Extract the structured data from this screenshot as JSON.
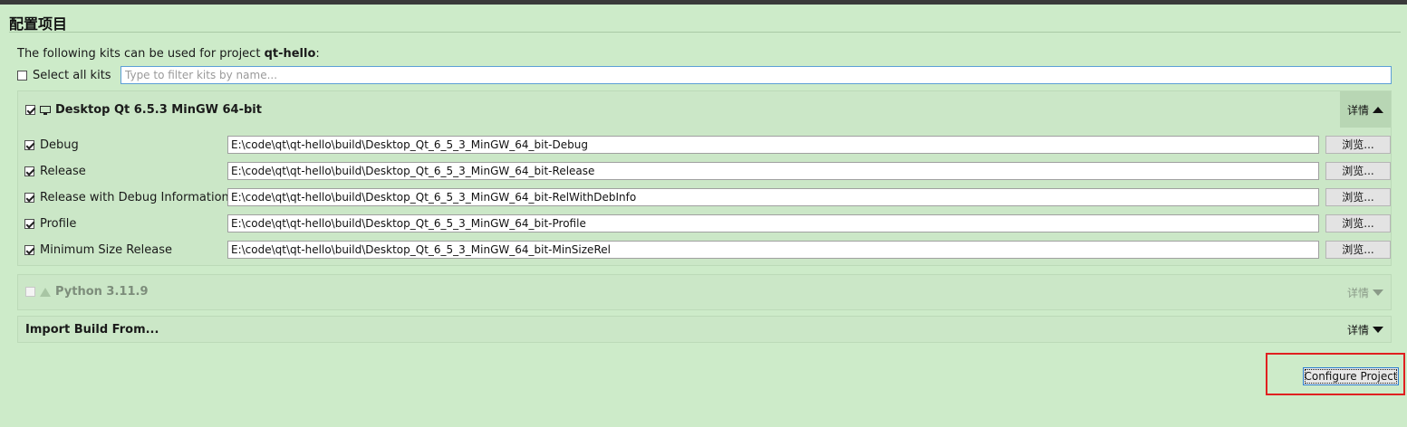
{
  "header": {
    "title": "配置项目"
  },
  "intro": {
    "prefix": "The following kits can be used for project ",
    "project": "qt-hello",
    "suffix": ":"
  },
  "select_all": {
    "label": "Select all kits",
    "checked": false
  },
  "filter": {
    "placeholder": "Type to filter kits by name...",
    "value": ""
  },
  "kits": [
    {
      "name": "Desktop Qt 6.5.3 MinGW 64-bit",
      "checked": true,
      "icon": "monitor-icon",
      "details_label": "详情",
      "expanded": true,
      "builds": [
        {
          "label": "Debug",
          "checked": true,
          "path": "E:\\code\\qt\\qt-hello\\build\\Desktop_Qt_6_5_3_MinGW_64_bit-Debug",
          "browse": "浏览..."
        },
        {
          "label": "Release",
          "checked": true,
          "path": "E:\\code\\qt\\qt-hello\\build\\Desktop_Qt_6_5_3_MinGW_64_bit-Release",
          "browse": "浏览..."
        },
        {
          "label": "Release with Debug Information",
          "checked": true,
          "path": "E:\\code\\qt\\qt-hello\\build\\Desktop_Qt_6_5_3_MinGW_64_bit-RelWithDebInfo",
          "browse": "浏览..."
        },
        {
          "label": "Profile",
          "checked": true,
          "path": "E:\\code\\qt\\qt-hello\\build\\Desktop_Qt_6_5_3_MinGW_64_bit-Profile",
          "browse": "浏览..."
        },
        {
          "label": "Minimum Size Release",
          "checked": true,
          "path": "E:\\code\\qt\\qt-hello\\build\\Desktop_Qt_6_5_3_MinGW_64_bit-MinSizeRel",
          "browse": "浏览..."
        }
      ]
    },
    {
      "name": "Python 3.11.9",
      "checked": false,
      "disabled": true,
      "icon": "warning-triangle-icon",
      "details_label": "详情",
      "expanded": false
    }
  ],
  "import": {
    "label": "Import Build From...",
    "details_label": "详情"
  },
  "configure_button": {
    "label": "Configure Project"
  },
  "colors": {
    "background": "#cdebc9",
    "highlight_border": "#e02020",
    "focus_blue": "#2f7fd0"
  }
}
